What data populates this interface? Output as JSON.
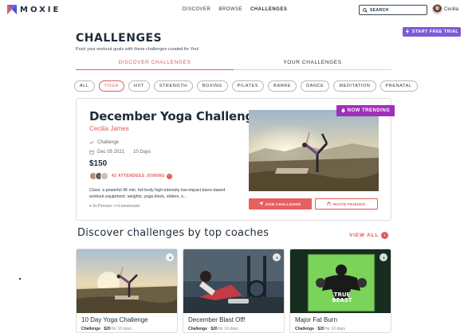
{
  "brand": {
    "name": "MOXIE",
    "accent": "#e15a5a",
    "purple": "#7b5cd6",
    "trending_color": "#a02fb9"
  },
  "nav": {
    "items": [
      "DISCOVER",
      "BROWSE",
      "CHALLENGES"
    ],
    "active": "CHALLENGES"
  },
  "search": {
    "placeholder": "SEARCH",
    "icon": "search-icon"
  },
  "user": {
    "name": "Cecilia",
    "icon": "avatar"
  },
  "trial_button": {
    "label": "START FREE TRIAL",
    "icon": "lightning-icon"
  },
  "page": {
    "title": "CHALLENGES",
    "subtitle": "Push your workout goals with these challenges curated for You!"
  },
  "tabs": [
    {
      "label": "DISCOVER CHALLENGES",
      "active": true
    },
    {
      "label": "YOUR CHALLENGES",
      "active": false
    }
  ],
  "chips": [
    "ALL",
    "YOGA",
    "HIIT",
    "STRENGTH",
    "BOXING",
    "PILATES",
    "BARRE",
    "DANCE",
    "MEDITATION",
    "PRENATAL"
  ],
  "active_chip": "YOGA",
  "featured": {
    "title": "December Yoga Challenge",
    "coach": "Cecilia James",
    "type": "Challenge",
    "date": "Dec 05 2021",
    "duration": "10 Days",
    "price": "$150",
    "attendees_text": "42 ATTENDEES JOINING",
    "description": "Class: a powerful 45 min. full body high-intensity low-impact barre-based workout equipment: weights, yoga block, sliders, s...",
    "location": "In-Person  >>Livestream",
    "badge": "NOW TRENDING",
    "join_label": "JOIN CHALLENGE",
    "invite_label": "INVITE FRIENDS"
  },
  "coaches_section": {
    "title": "Discover challenges by top coaches",
    "view_all": "VIEW ALL"
  },
  "cards": [
    {
      "title": "10 Day Yoga Challenge",
      "kind": "Challenge",
      "price": "$20",
      "duration": "for 10 days"
    },
    {
      "title": "December Blast Off!",
      "kind": "Challenge",
      "price": "$20",
      "duration": "for 10 days"
    },
    {
      "title": "Major Fat Burn",
      "kind": "Challenge",
      "price": "$20",
      "duration": "for 10 days",
      "image_text": [
        "TRUE",
        "BEAST"
      ]
    }
  ]
}
